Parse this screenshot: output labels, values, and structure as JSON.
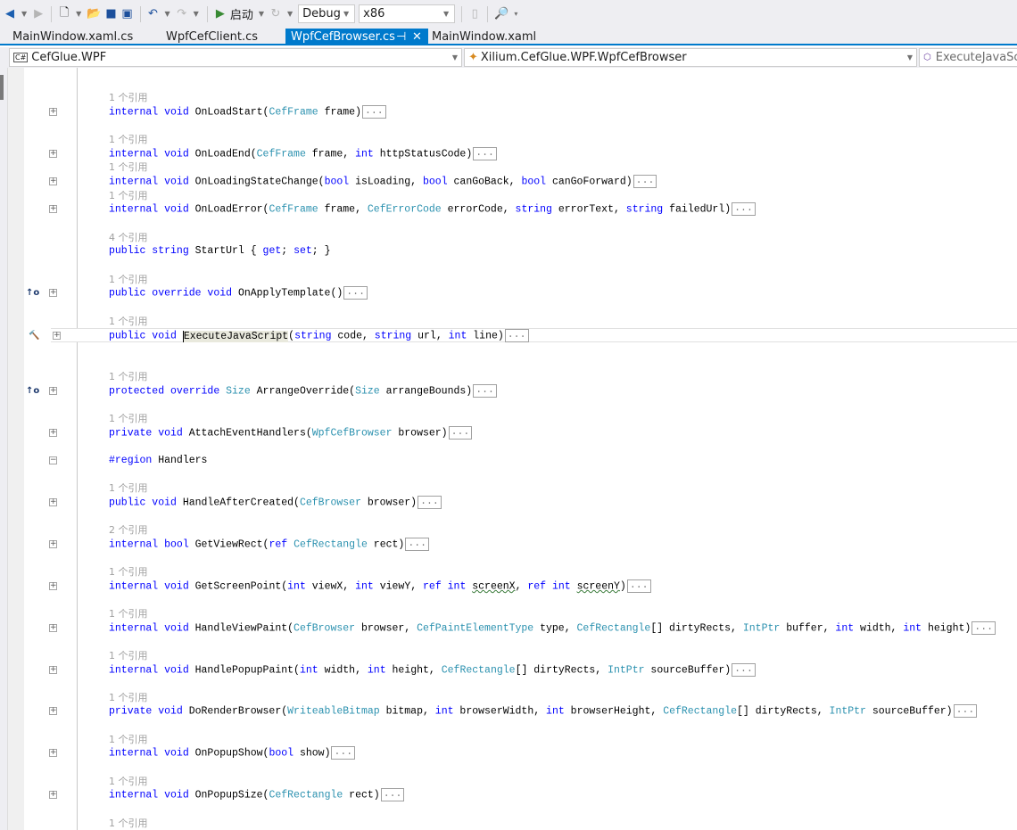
{
  "toolbar": {
    "back_icon": "back-arrow-icon",
    "forward_icon": "forward-arrow-icon",
    "start_label": "启动",
    "config": "Debug",
    "platform": "x86"
  },
  "tabs": [
    {
      "label": "MainWindow.xaml.cs",
      "active": false
    },
    {
      "label": "WpfCefClient.cs",
      "active": false
    },
    {
      "label": "WpfCefBrowser.cs",
      "active": true,
      "pin": "⊣",
      "close": "✕"
    },
    {
      "label": "MainWindow.xaml",
      "active": false
    }
  ],
  "navbar": {
    "project": "CefGlue.WPF",
    "project_icon": "C#",
    "type": "Xilium.CefGlue.WPF.WpfCefBrowser",
    "member": "ExecuteJavaScri"
  },
  "colors": {
    "keyword": "#0000ff",
    "type": "#2b91af",
    "accent": "#007acc",
    "refs": "#a0a0a0"
  },
  "code": {
    "more": "...",
    "lines": [
      {
        "kind": "blank"
      },
      {
        "kind": "blank"
      },
      {
        "kind": "ref",
        "text": "1 个引用"
      },
      {
        "kind": "code",
        "tokens": [
          [
            "k",
            "internal void "
          ],
          [
            "p",
            "OnLoadStart("
          ],
          [
            "t",
            "CefFrame"
          ],
          [
            "p",
            " frame)"
          ]
        ],
        "more": true
      },
      {
        "kind": "blank"
      },
      {
        "kind": "ref",
        "text": "1 个引用"
      },
      {
        "kind": "code",
        "tokens": [
          [
            "k",
            "internal void "
          ],
          [
            "p",
            "OnLoadEnd("
          ],
          [
            "t",
            "CefFrame"
          ],
          [
            "p",
            " frame, "
          ],
          [
            "k",
            "int"
          ],
          [
            "p",
            " httpStatusCode)"
          ]
        ],
        "more": true
      },
      {
        "kind": "ref",
        "text": "1 个引用"
      },
      {
        "kind": "code",
        "tokens": [
          [
            "k",
            "internal void "
          ],
          [
            "p",
            "OnLoadingStateChange("
          ],
          [
            "k",
            "bool"
          ],
          [
            "p",
            " isLoading, "
          ],
          [
            "k",
            "bool"
          ],
          [
            "p",
            " canGoBack, "
          ],
          [
            "k",
            "bool"
          ],
          [
            "p",
            " canGoForward)"
          ]
        ],
        "more": true
      },
      {
        "kind": "ref",
        "text": "1 个引用"
      },
      {
        "kind": "code",
        "tokens": [
          [
            "k",
            "internal void "
          ],
          [
            "p",
            "OnLoadError("
          ],
          [
            "t",
            "CefFrame"
          ],
          [
            "p",
            " frame, "
          ],
          [
            "t",
            "CefErrorCode"
          ],
          [
            "p",
            " errorCode, "
          ],
          [
            "k",
            "string"
          ],
          [
            "p",
            " errorText, "
          ],
          [
            "k",
            "string"
          ],
          [
            "p",
            " failedUrl)"
          ]
        ],
        "more": true
      },
      {
        "kind": "blank"
      },
      {
        "kind": "ref",
        "text": "4 个引用"
      },
      {
        "kind": "code",
        "tokens": [
          [
            "k",
            "public string "
          ],
          [
            "p",
            "StartUrl { "
          ],
          [
            "k",
            "get"
          ],
          [
            "p",
            "; "
          ],
          [
            "k",
            "set"
          ],
          [
            "p",
            "; }"
          ]
        ],
        "more": false,
        "nofold": true
      },
      {
        "kind": "blank"
      },
      {
        "kind": "ref",
        "text": "1 个引用"
      },
      {
        "kind": "code",
        "glyph": "↑o",
        "glyph_name": "override-glyph-icon",
        "tokens": [
          [
            "k",
            "public override void "
          ],
          [
            "p",
            "OnApplyTemplate()"
          ]
        ],
        "more": true
      },
      {
        "kind": "blank"
      },
      {
        "kind": "ref",
        "text": "1 个引用"
      },
      {
        "kind": "code",
        "glyph": "🔨",
        "glyph_name": "hammer-icon",
        "highlight": true,
        "tokens": [
          [
            "k",
            "public void "
          ],
          [
            "h",
            "ExecuteJavaScript"
          ],
          [
            "p",
            "("
          ],
          [
            "k",
            "string"
          ],
          [
            "p",
            " code, "
          ],
          [
            "k",
            "string"
          ],
          [
            "p",
            " url, "
          ],
          [
            "k",
            "int"
          ],
          [
            "p",
            " line)"
          ]
        ],
        "more": true
      },
      {
        "kind": "blank"
      },
      {
        "kind": "blank"
      },
      {
        "kind": "ref",
        "text": "1 个引用"
      },
      {
        "kind": "code",
        "glyph": "↑o",
        "glyph_name": "override-glyph-icon",
        "tokens": [
          [
            "k",
            "protected override "
          ],
          [
            "t",
            "Size"
          ],
          [
            "p",
            " ArrangeOverride("
          ],
          [
            "t",
            "Size"
          ],
          [
            "p",
            " arrangeBounds)"
          ]
        ],
        "more": true
      },
      {
        "kind": "blank"
      },
      {
        "kind": "ref",
        "text": "1 个引用"
      },
      {
        "kind": "code",
        "tokens": [
          [
            "k",
            "private void "
          ],
          [
            "p",
            "AttachEventHandlers("
          ],
          [
            "t",
            "WpfCefBrowser"
          ],
          [
            "p",
            " browser)"
          ]
        ],
        "more": true
      },
      {
        "kind": "blank"
      },
      {
        "kind": "code",
        "expanded": true,
        "tokens": [
          [
            "k",
            "#region "
          ],
          [
            "p",
            "Handlers"
          ]
        ],
        "more": false
      },
      {
        "kind": "blank"
      },
      {
        "kind": "ref",
        "text": "1 个引用"
      },
      {
        "kind": "code",
        "tokens": [
          [
            "k",
            "public void "
          ],
          [
            "p",
            "HandleAfterCreated("
          ],
          [
            "t",
            "CefBrowser"
          ],
          [
            "p",
            " browser)"
          ]
        ],
        "more": true
      },
      {
        "kind": "blank"
      },
      {
        "kind": "ref",
        "text": "2 个引用"
      },
      {
        "kind": "code",
        "tokens": [
          [
            "k",
            "internal bool "
          ],
          [
            "p",
            "GetViewRect("
          ],
          [
            "k",
            "ref "
          ],
          [
            "t",
            "CefRectangle"
          ],
          [
            "p",
            " rect)"
          ]
        ],
        "more": true
      },
      {
        "kind": "blank"
      },
      {
        "kind": "ref",
        "text": "1 个引用"
      },
      {
        "kind": "code",
        "tokens": [
          [
            "k",
            "internal void "
          ],
          [
            "p",
            "GetScreenPoint("
          ],
          [
            "k",
            "int"
          ],
          [
            "p",
            " viewX, "
          ],
          [
            "k",
            "int"
          ],
          [
            "p",
            " viewY, "
          ],
          [
            "k",
            "ref int "
          ],
          [
            "s",
            "screenX"
          ],
          [
            "p",
            ", "
          ],
          [
            "k",
            "ref int "
          ],
          [
            "s",
            "screenY"
          ],
          [
            "p",
            ")"
          ]
        ],
        "more": true
      },
      {
        "kind": "blank"
      },
      {
        "kind": "ref",
        "text": "1 个引用"
      },
      {
        "kind": "code",
        "tokens": [
          [
            "k",
            "internal void "
          ],
          [
            "p",
            "HandleViewPaint("
          ],
          [
            "t",
            "CefBrowser"
          ],
          [
            "p",
            " browser, "
          ],
          [
            "t",
            "CefPaintElementType"
          ],
          [
            "p",
            " type, "
          ],
          [
            "t",
            "CefRectangle"
          ],
          [
            "p",
            "[] dirtyRects, "
          ],
          [
            "t",
            "IntPtr"
          ],
          [
            "p",
            " buffer, "
          ],
          [
            "k",
            "int"
          ],
          [
            "p",
            " width, "
          ],
          [
            "k",
            "int"
          ],
          [
            "p",
            " height)"
          ]
        ],
        "more": true
      },
      {
        "kind": "blank"
      },
      {
        "kind": "ref",
        "text": "1 个引用"
      },
      {
        "kind": "code",
        "tokens": [
          [
            "k",
            "internal void "
          ],
          [
            "p",
            "HandlePopupPaint("
          ],
          [
            "k",
            "int"
          ],
          [
            "p",
            " width, "
          ],
          [
            "k",
            "int"
          ],
          [
            "p",
            " height, "
          ],
          [
            "t",
            "CefRectangle"
          ],
          [
            "p",
            "[] dirtyRects, "
          ],
          [
            "t",
            "IntPtr"
          ],
          [
            "p",
            " sourceBuffer)"
          ]
        ],
        "more": true
      },
      {
        "kind": "blank"
      },
      {
        "kind": "ref",
        "text": "1 个引用"
      },
      {
        "kind": "code",
        "tokens": [
          [
            "k",
            "private void "
          ],
          [
            "p",
            "DoRenderBrowser("
          ],
          [
            "t",
            "WriteableBitmap"
          ],
          [
            "p",
            " bitmap, "
          ],
          [
            "k",
            "int"
          ],
          [
            "p",
            " browserWidth, "
          ],
          [
            "k",
            "int"
          ],
          [
            "p",
            " browserHeight, "
          ],
          [
            "t",
            "CefRectangle"
          ],
          [
            "p",
            "[] dirtyRects, "
          ],
          [
            "t",
            "IntPtr"
          ],
          [
            "p",
            " sourceBuffer)"
          ]
        ],
        "more": true
      },
      {
        "kind": "blank"
      },
      {
        "kind": "ref",
        "text": "1 个引用"
      },
      {
        "kind": "code",
        "tokens": [
          [
            "k",
            "internal void "
          ],
          [
            "p",
            "OnPopupShow("
          ],
          [
            "k",
            "bool"
          ],
          [
            "p",
            " show)"
          ]
        ],
        "more": true
      },
      {
        "kind": "blank"
      },
      {
        "kind": "ref",
        "text": "1 个引用"
      },
      {
        "kind": "code",
        "tokens": [
          [
            "k",
            "internal void "
          ],
          [
            "p",
            "OnPopupSize("
          ],
          [
            "t",
            "CefRectangle"
          ],
          [
            "p",
            " rect)"
          ]
        ],
        "more": true
      },
      {
        "kind": "blank"
      },
      {
        "kind": "ref",
        "text": "1 个引用"
      }
    ]
  }
}
